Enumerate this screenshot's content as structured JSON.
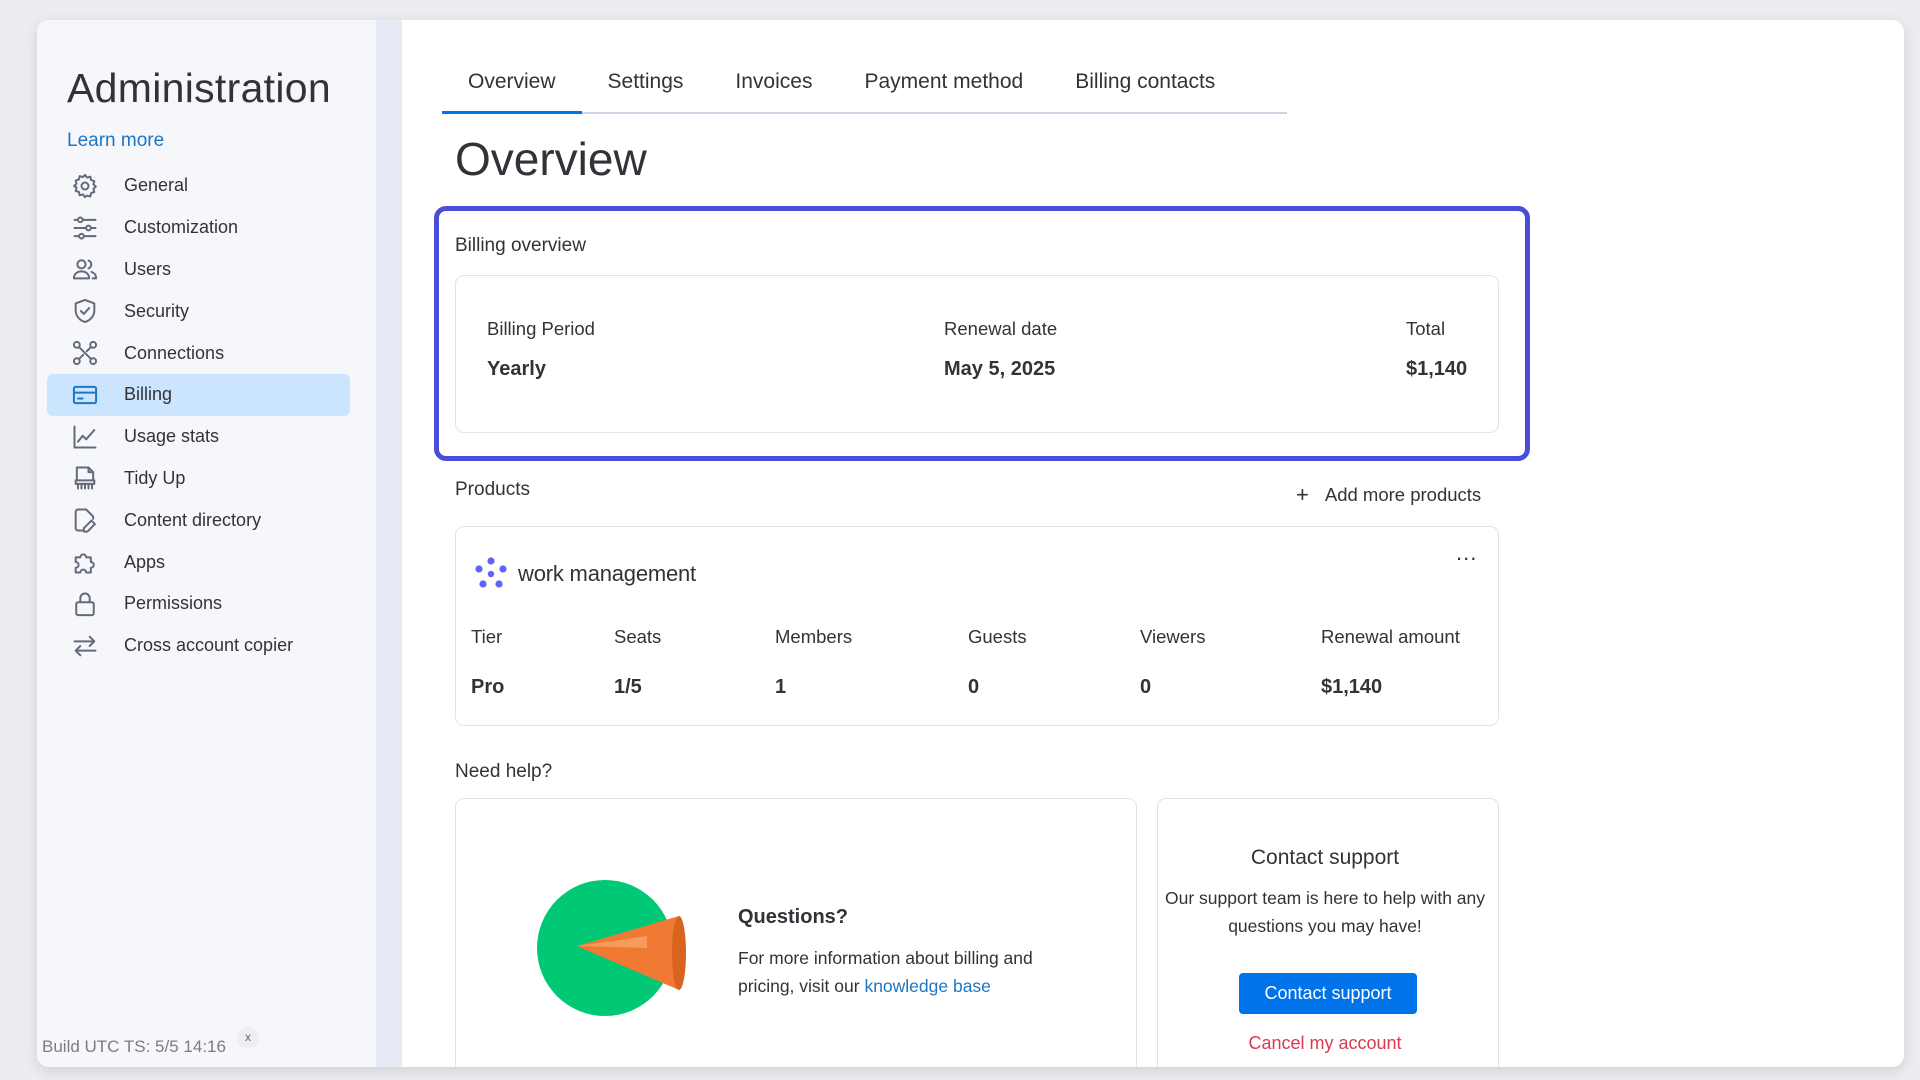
{
  "sidebar": {
    "title": "Administration",
    "learn_more": "Learn more",
    "items": [
      {
        "label": "General",
        "icon": "gear-icon"
      },
      {
        "label": "Customization",
        "icon": "sliders-icon"
      },
      {
        "label": "Users",
        "icon": "users-icon"
      },
      {
        "label": "Security",
        "icon": "shield-icon"
      },
      {
        "label": "Connections",
        "icon": "connections-icon"
      },
      {
        "label": "Billing",
        "icon": "credit-card-icon",
        "active": true
      },
      {
        "label": "Usage stats",
        "icon": "chart-icon"
      },
      {
        "label": "Tidy Up",
        "icon": "tidy-up-icon"
      },
      {
        "label": "Content directory",
        "icon": "edit-document-icon"
      },
      {
        "label": "Apps",
        "icon": "puzzle-icon"
      },
      {
        "label": "Permissions",
        "icon": "lock-icon"
      },
      {
        "label": "Cross account copier",
        "icon": "transfer-arrows-icon"
      }
    ],
    "build_ts": "Build UTC TS: 5/5 14:16",
    "build_close": "x"
  },
  "tabs": [
    {
      "label": "Overview",
      "active": true
    },
    {
      "label": "Settings"
    },
    {
      "label": "Invoices"
    },
    {
      "label": "Payment method"
    },
    {
      "label": "Billing contacts"
    }
  ],
  "page_title": "Overview",
  "billing_overview": {
    "title": "Billing overview",
    "period_label": "Billing Period",
    "period_value": "Yearly",
    "renewal_label": "Renewal date",
    "renewal_value": "May 5, 2025",
    "total_label": "Total",
    "total_value": "$1,140"
  },
  "products": {
    "title": "Products",
    "add_label": "Add more products",
    "product_name": "work management",
    "more_menu": "...",
    "columns": [
      "Tier",
      "Seats",
      "Members",
      "Guests",
      "Viewers",
      "Renewal amount"
    ],
    "values": [
      "Pro",
      "1/5",
      "1",
      "0",
      "0",
      "$1,140"
    ]
  },
  "help": {
    "title": "Need help?",
    "questions_title": "Questions?",
    "questions_text": "For more information about billing and pricing, visit our ",
    "knowledge_link": "knowledge base",
    "contact_title": "Contact support",
    "contact_text": "Our support team is here to help with any questions you may have!",
    "contact_button": "Contact support",
    "cancel_link": "Cancel my account"
  },
  "colors": {
    "accent": "#0073ea",
    "highlight_border": "#4a4dd8",
    "active_nav": "#cce5ff",
    "link": "#1f76c2",
    "danger": "#d83a52",
    "megaphone_circle": "#00c875",
    "megaphone": "#f07a33"
  }
}
